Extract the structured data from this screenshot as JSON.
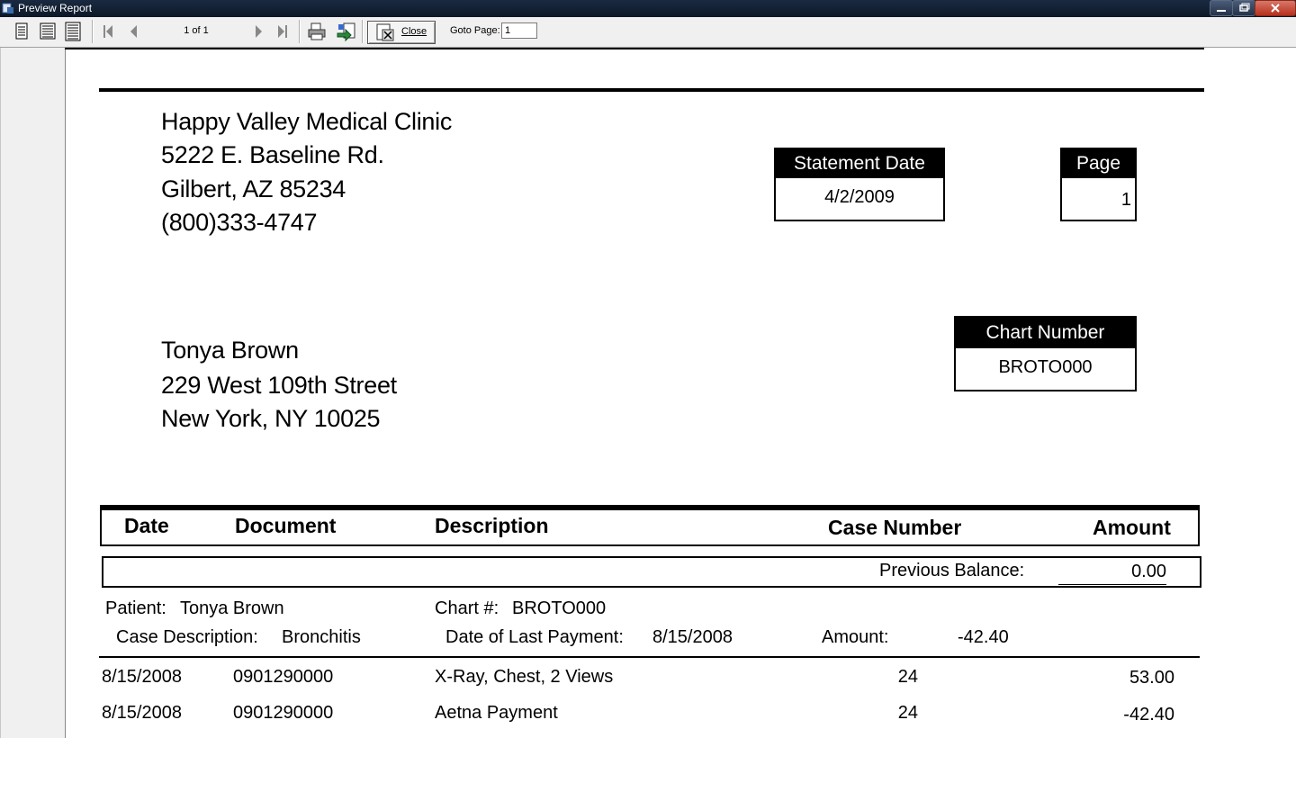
{
  "window": {
    "title": "Preview Report"
  },
  "toolbar": {
    "page_indicator": "1 of 1",
    "close_label": "Close",
    "goto_label": "Goto Page:",
    "goto_value": "1"
  },
  "clinic": {
    "name": "Happy Valley Medical Clinic",
    "address1": "5222 E. Baseline Rd.",
    "address2": "Gilbert, AZ 85234",
    "phone": "(800)333-4747"
  },
  "statement_date": {
    "label": "Statement Date",
    "value": "4/2/2009"
  },
  "page_box": {
    "label": "Page",
    "value": "1"
  },
  "chart_box": {
    "label": "Chart Number",
    "value": "BROTO000"
  },
  "patient": {
    "name": "Tonya Brown",
    "address1": "229 West 109th Street",
    "address2": "New York, NY 10025"
  },
  "table": {
    "headers": {
      "date": "Date",
      "document": "Document",
      "description": "Description",
      "case_number": "Case Number",
      "amount": "Amount"
    },
    "previous_balance": {
      "label": "Previous Balance:",
      "value": "0.00"
    },
    "case_info": {
      "patient_label": "Patient:",
      "patient_value": "Tonya Brown",
      "chart_label": "Chart #:",
      "chart_value": "BROTO000",
      "case_desc_label": "Case Description:",
      "case_desc_value": "Bronchitis",
      "last_payment_label": "Date of Last Payment:",
      "last_payment_value": "8/15/2008",
      "amount_label": "Amount:",
      "amount_value": "-42.40"
    },
    "rows": [
      {
        "date": "8/15/2008",
        "document": "0901290000",
        "description": "X-Ray, Chest, 2 Views",
        "case_number": "24",
        "amount": "53.00"
      },
      {
        "date": "8/15/2008",
        "document": "0901290000",
        "description": "Aetna Payment",
        "case_number": "24",
        "amount": "-42.40"
      }
    ]
  }
}
